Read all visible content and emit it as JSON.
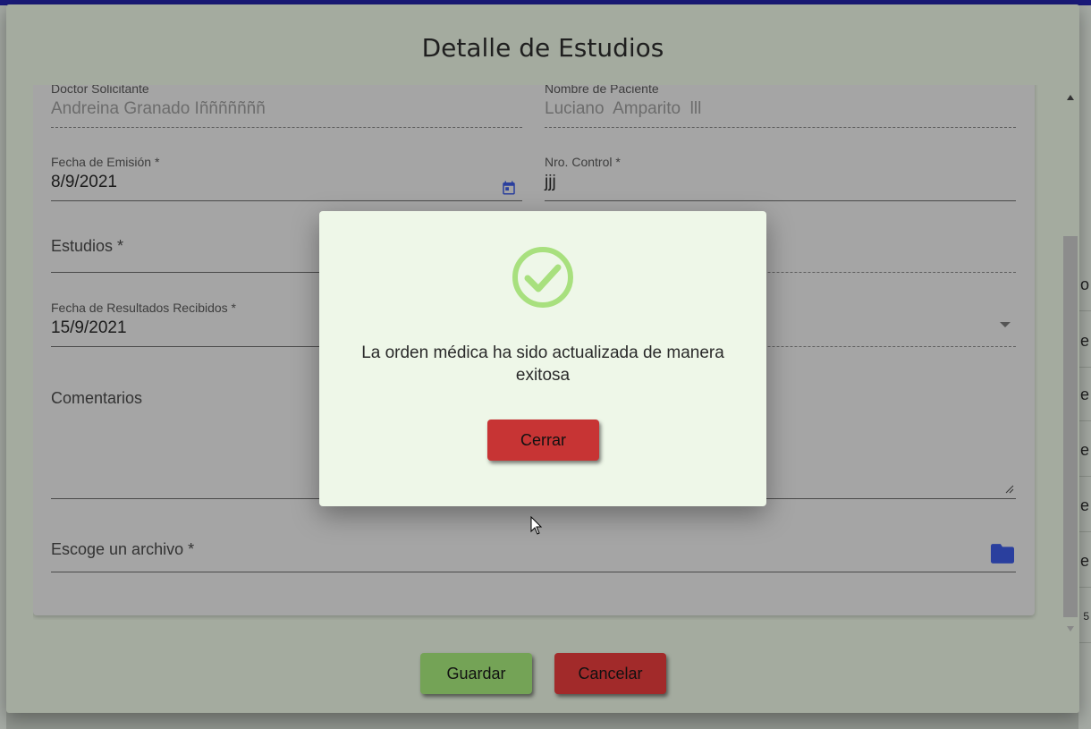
{
  "dialog": {
    "title": "Detalle de Estudios"
  },
  "form": {
    "doctor": {
      "label": "Doctor Solicitante",
      "value": "Andreina Granado Iñññññññ"
    },
    "patient": {
      "label": "Nombre de Paciente",
      "value": "Luciano  Amparito  lll"
    },
    "emission_date": {
      "label": "Fecha de Emisión *",
      "value": "8/9/2021"
    },
    "control_number": {
      "label": "Nro. Control *",
      "value": "jjj"
    },
    "studies": {
      "placeholder": "Estudios *"
    },
    "results_date": {
      "label": "Fecha de Resultados Recibidos *",
      "value": "15/9/2021"
    },
    "comments": {
      "placeholder": "Comentarios"
    },
    "file": {
      "placeholder": "Escoge un archivo *"
    }
  },
  "buttons": {
    "save": "Guardar",
    "cancel": "Cancelar"
  },
  "alert": {
    "message": "La orden médica ha sido actualizada de manera exitosa",
    "close": "Cerrar",
    "icon": "check-circle-icon"
  },
  "background": {
    "right_cells": [
      "o",
      "e",
      "e",
      "e",
      "e",
      "e",
      "5"
    ]
  },
  "colors": {
    "success_icon": "#a8e07e",
    "save_button": "#74a356",
    "cancel_button": "#a22a2a",
    "close_button": "#c73434",
    "icon_blue": "#2a3f9e"
  }
}
